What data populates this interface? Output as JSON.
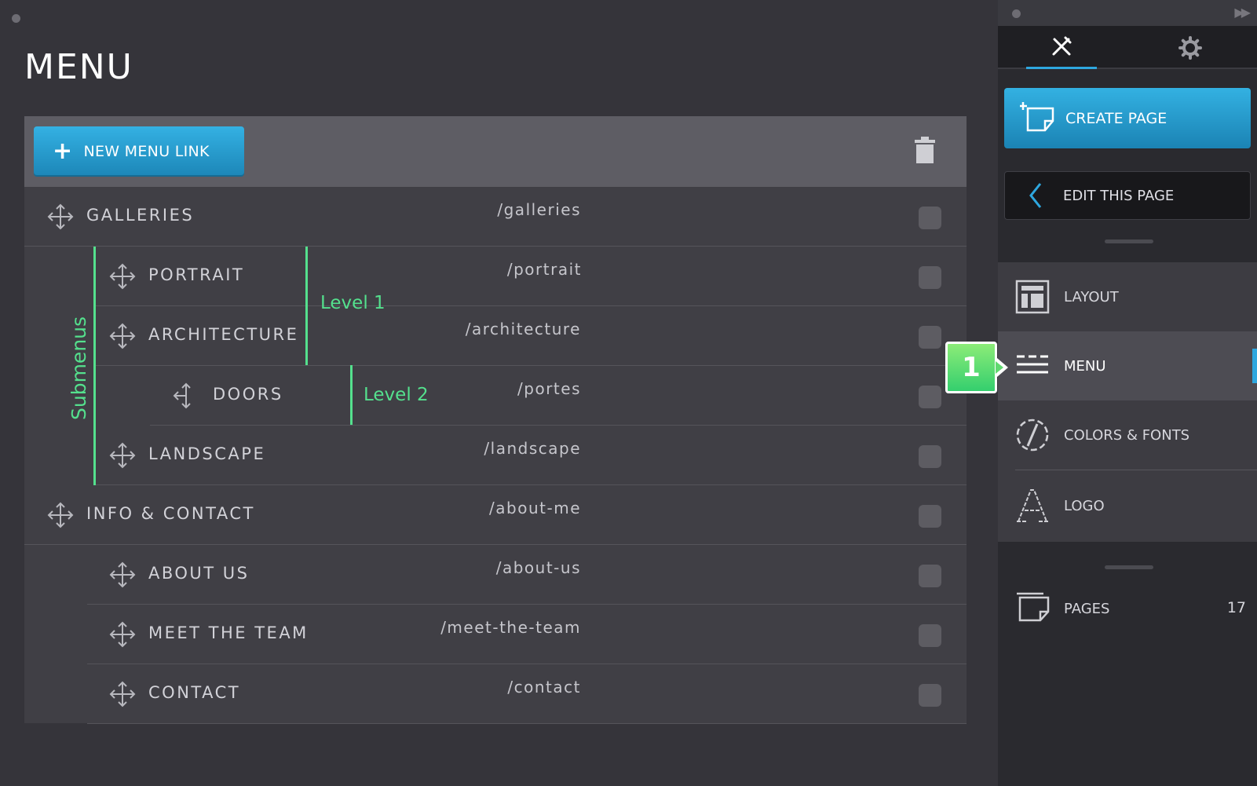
{
  "page": {
    "title": "MENU"
  },
  "toolbar": {
    "new_link_label": "NEW MENU LINK",
    "plus_glyph": "+",
    "trash_icon": "trash-icon"
  },
  "rows": [
    {
      "label": "GALLERIES",
      "path": "/galleries"
    },
    {
      "label": "PORTRAIT",
      "path": "/portrait"
    },
    {
      "label": "ARCHITECTURE",
      "path": "/architecture"
    },
    {
      "label": "DOORS",
      "path": "/portes"
    },
    {
      "label": "LANDSCAPE",
      "path": "/landscape"
    },
    {
      "label": "INFO & CONTACT",
      "path": "/about-me"
    },
    {
      "label": "ABOUT US",
      "path": "/about-us"
    },
    {
      "label": "MEET THE TEAM",
      "path": "/meet-the-team"
    },
    {
      "label": "CONTACT",
      "path": "/contact"
    }
  ],
  "annotations": {
    "submenus": "Submenus",
    "level1": "Level 1",
    "level2": "Level 2",
    "callout": "1"
  },
  "sidebar": {
    "create_page_label": "CREATE PAGE",
    "edit_page_label": "EDIT THIS PAGE",
    "items": [
      {
        "label": "LAYOUT"
      },
      {
        "label": "MENU"
      },
      {
        "label": "COLORS & FONTS"
      },
      {
        "label": "LOGO"
      }
    ],
    "pages": {
      "label": "PAGES",
      "count": "17"
    }
  },
  "colors": {
    "accent": "#2ea7df",
    "annotation": "#54e08d",
    "callout": "#5fd96f"
  }
}
